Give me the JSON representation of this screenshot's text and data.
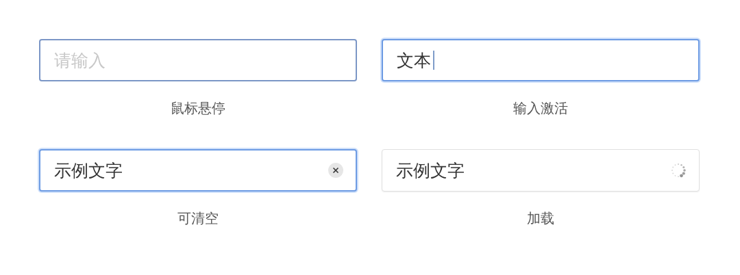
{
  "fields": [
    {
      "kind": "hover",
      "placeholder": "请输入",
      "caption": "鼠标悬停"
    },
    {
      "kind": "focused",
      "value": "文本",
      "caption": "输入激活"
    },
    {
      "kind": "clearable",
      "value": "示例文字",
      "caption": "可清空"
    },
    {
      "kind": "loading",
      "value": "示例文字",
      "caption": "加载"
    }
  ]
}
